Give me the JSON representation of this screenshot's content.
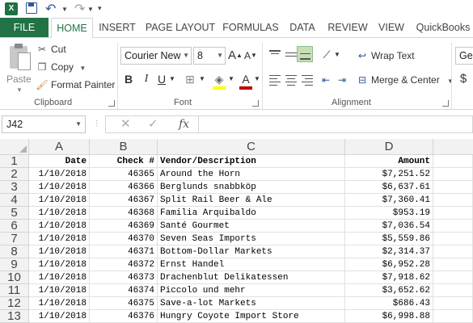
{
  "qat": {
    "app_icon": "excel-icon",
    "icons": [
      "save-icon",
      "undo-icon",
      "redo-icon",
      "customize-icon"
    ]
  },
  "tabs": [
    {
      "label": "FILE"
    },
    {
      "label": "HOME"
    },
    {
      "label": "INSERT"
    },
    {
      "label": "PAGE LAYOUT"
    },
    {
      "label": "FORMULAS"
    },
    {
      "label": "DATA"
    },
    {
      "label": "REVIEW"
    },
    {
      "label": "VIEW"
    },
    {
      "label": "QuickBooks"
    }
  ],
  "ribbon": {
    "clipboard": {
      "paste_label": "Paste",
      "cut_label": "Cut",
      "copy_label": "Copy",
      "format_painter_label": "Format Painter",
      "group_label": "Clipboard"
    },
    "font": {
      "font_name": "Courier New",
      "font_size": "8",
      "bold": "B",
      "italic": "I",
      "underline": "U",
      "grow": "A",
      "shrink": "A",
      "font_color_letter": "A",
      "group_label": "Font"
    },
    "alignment": {
      "wrap_text_label": "Wrap Text",
      "merge_label": "Merge & Center",
      "group_label": "Alignment"
    },
    "number": {
      "format_value": "Ger",
      "currency_symbol": "$"
    }
  },
  "formula_bar": {
    "name_box": "J42",
    "fx": "fx",
    "content": ""
  },
  "grid": {
    "columns": [
      "A",
      "B",
      "C",
      "D"
    ],
    "rows": [
      {
        "num": "1",
        "cells": [
          "Date",
          "Check #",
          "Vendor/Description",
          "Amount"
        ]
      },
      {
        "num": "2",
        "cells": [
          "1/10/2018",
          "46365",
          "Around the Horn",
          "$7,251.52"
        ]
      },
      {
        "num": "3",
        "cells": [
          "1/10/2018",
          "46366",
          "Berglunds snabbköp",
          "$6,637.61"
        ]
      },
      {
        "num": "4",
        "cells": [
          "1/10/2018",
          "46367",
          "Split Rail Beer & Ale",
          "$7,360.41"
        ]
      },
      {
        "num": "5",
        "cells": [
          "1/10/2018",
          "46368",
          "Familia Arquibaldo",
          "$953.19"
        ]
      },
      {
        "num": "6",
        "cells": [
          "1/10/2018",
          "46369",
          "Santé Gourmet",
          "$7,036.54"
        ]
      },
      {
        "num": "7",
        "cells": [
          "1/10/2018",
          "46370",
          "Seven Seas Imports",
          "$5,559.86"
        ]
      },
      {
        "num": "8",
        "cells": [
          "1/10/2018",
          "46371",
          "Bottom-Dollar Markets",
          "$2,314.37"
        ]
      },
      {
        "num": "9",
        "cells": [
          "1/10/2018",
          "46372",
          "Ernst Handel",
          "$6,952.28"
        ]
      },
      {
        "num": "10",
        "cells": [
          "1/10/2018",
          "46373",
          "Drachenblut Delikatessen",
          "$7,918.62"
        ]
      },
      {
        "num": "11",
        "cells": [
          "1/10/2018",
          "46374",
          "Piccolo und mehr",
          "$3,652.62"
        ]
      },
      {
        "num": "12",
        "cells": [
          "1/10/2018",
          "46375",
          "Save-a-lot Markets",
          "$686.43"
        ]
      },
      {
        "num": "13",
        "cells": [
          "1/10/2018",
          "46376",
          "Hungry Coyote Import Store",
          "$6,998.88"
        ]
      }
    ]
  },
  "colors": {
    "excel_green": "#217346",
    "font_color_bar": "#c00000",
    "highlight_bar": "#ffff00"
  }
}
